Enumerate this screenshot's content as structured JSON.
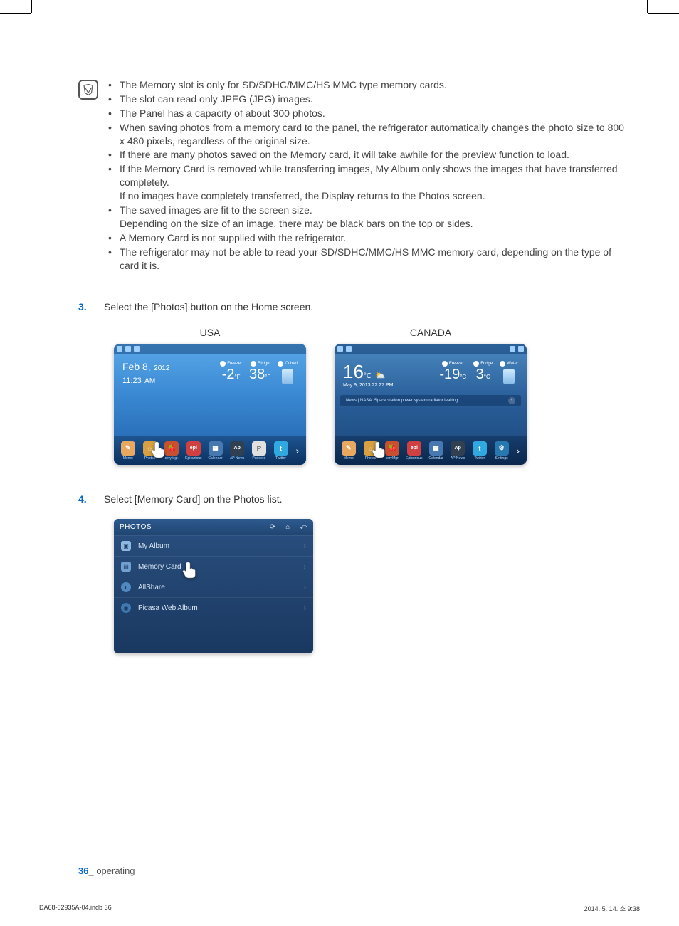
{
  "notes": {
    "b1": "The Memory slot is only for SD/SDHC/MMC/HS MMC type memory cards.",
    "b2": "The slot can read only JPEG (JPG) images.",
    "b3": "The Panel has a capacity of about 300 photos.",
    "b4": "When saving photos from a memory card to the panel, the refrigerator automatically changes the photo size to 800 x 480 pixels, regardless of the original size.",
    "b5": "If there are many photos saved on the Memory card, it will take awhile for the preview function to load.",
    "b6": "If the Memory Card is removed while transferring images, My Album only shows the images that have transferred completely.",
    "b6sub": "If no images have completely transferred, the Display returns to the Photos screen.",
    "b7": "The saved images are fit to the screen size.",
    "b7sub": "Depending on the size of an image, there may be black bars on the top or sides.",
    "b8": "A Memory Card is not supplied with the refrigerator.",
    "b9": "The refrigerator may not be able to read your SD/SDHC/MMC/HS MMC memory card, depending on the type of card it is."
  },
  "steps": {
    "s3num": "3.",
    "s3text": "Select the [Photos] button on the Home screen.",
    "s4num": "4.",
    "s4text": "Select [Memory Card] on the Photos list."
  },
  "labels": {
    "usa": "USA",
    "canada": "CANADA"
  },
  "usa_screen": {
    "date": "Feb 8,",
    "year": "2012",
    "time": "11:23",
    "ampm": "AM",
    "freezer_label": "Freezer",
    "freezer_val": "-2",
    "freezer_unit": "°F",
    "fridge_label": "Fridge",
    "fridge_val": "38",
    "fridge_unit": "°F",
    "cubed_label": "Cubed",
    "apps": {
      "memo": "Memo",
      "photos": "Photos",
      "gmgr": "ceryMgr.",
      "epi": "Epicurious",
      "cal": "Calendar",
      "ap": "AP News",
      "pan": "Pandora",
      "tw": "Twitter"
    }
  },
  "canada_screen": {
    "big_temp": "16",
    "big_unit": "°C",
    "datetime": "May 9, 2013 22:27",
    "tz": "PM",
    "freezer_label": "Freezer",
    "freezer_val": "-19",
    "freezer_unit": "°C",
    "fridge_label": "Fridge",
    "fridge_val": "3",
    "fridge_unit": "°C",
    "water_label": "Water",
    "news": "News | NASA: Space station power system radiator leaking",
    "apps": {
      "memo": "Memo",
      "photos": "Photos",
      "gmgr": "ceryMgr.",
      "epi": "Epicurious",
      "cal": "Calendar",
      "ap": "AP News",
      "tw": "Twitter",
      "set": "Settings"
    }
  },
  "photos_panel": {
    "title": "PHOTOS",
    "rows": {
      "r1": "My Album",
      "r2": "Memory Card",
      "r3": "AllShare",
      "r4": "Picasa Web Album"
    }
  },
  "footer": {
    "page": "36",
    "sep": "_",
    "section": " operating"
  },
  "print": {
    "left": "DA68-02935A-04.indb   36",
    "right": "2014. 5. 14.   소 9:38"
  }
}
